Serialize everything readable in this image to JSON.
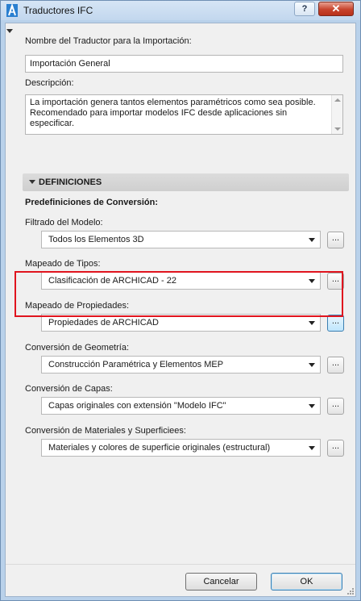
{
  "window": {
    "title": "Traductores IFC",
    "help_label": "?",
    "close_label": "✕"
  },
  "form": {
    "translator_name_label": "Nombre del Traductor para la Importación:",
    "translator_name_value": "Importación General",
    "description_label": "Descripción:",
    "description_value": "La importación genera tantos elementos paramétricos como sea posible. Recomendado para importar modelos IFC desde aplicaciones sin especificar."
  },
  "definitions": {
    "section_title": "DEFINICIONES",
    "subheading": "Predefiniciones de Conversión:",
    "settings": [
      {
        "label": "Filtrado del Modelo:",
        "value": "Todos los Elementos 3D",
        "button": "..."
      },
      {
        "label": "Mapeado de Tipos:",
        "value": "Clasificación de ARCHICAD - 22",
        "button": "..."
      },
      {
        "label": "Mapeado de Propiedades:",
        "value": "Propiedades de ARCHICAD",
        "button": "..."
      },
      {
        "label": "Conversión de Geometría:",
        "value": "Construcción Paramétrica y Elementos MEP",
        "button": "..."
      },
      {
        "label": "Conversión de Capas:",
        "value": "Capas originales con extensión \"Modelo IFC\"",
        "button": "..."
      },
      {
        "label": "Conversión de Materiales y Superficiees:",
        "value": "Materiales y colores de superficie originales (estructural)",
        "button": "..."
      }
    ]
  },
  "footer": {
    "cancel_label": "Cancelar",
    "ok_label": "OK"
  },
  "colors": {
    "highlight": "#e0141e",
    "window_frame": "#b9d1ea",
    "close_button": "#c7432c"
  },
  "icons": {
    "app": "archicad-logo-icon",
    "collapse": "triangle-down-icon",
    "dropdown": "chevron-down-icon",
    "resize": "resize-grip-icon"
  }
}
